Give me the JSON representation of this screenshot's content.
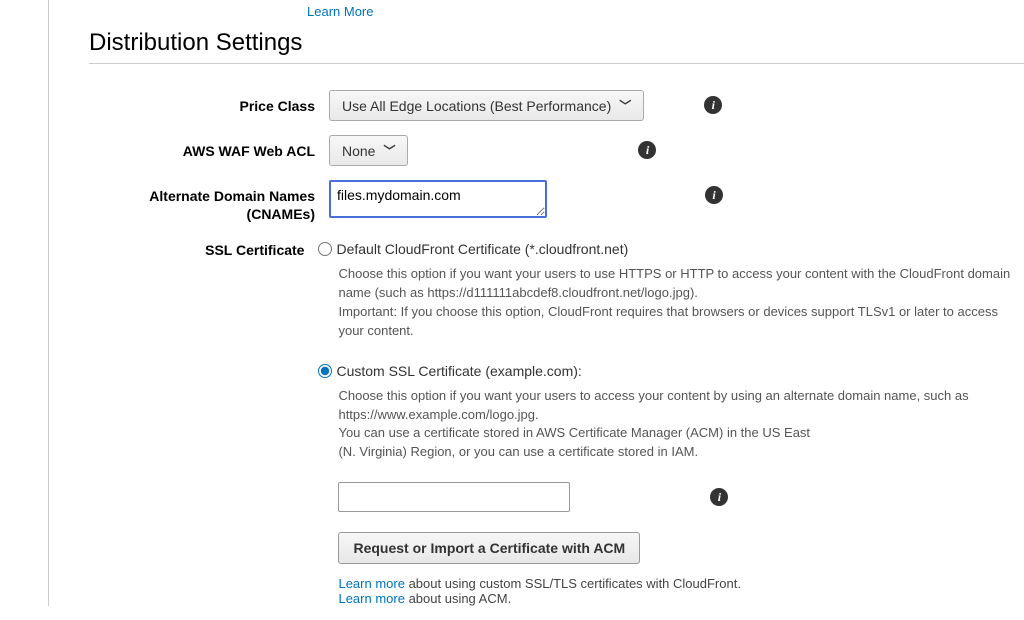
{
  "top_link": "Learn More",
  "section_title": "Distribution Settings",
  "price_class": {
    "label": "Price Class",
    "value": "Use All Edge Locations (Best Performance)"
  },
  "waf": {
    "label": "AWS WAF Web ACL",
    "value": "None"
  },
  "cnames": {
    "label": "Alternate Domain Names\n(CNAMEs)",
    "value": "files.mydomain.com"
  },
  "ssl": {
    "label": "SSL Certificate",
    "default_option": "Default CloudFront Certificate (*.cloudfront.net)",
    "default_desc_1": "Choose this option if you want your users to use HTTPS or HTTP to access your content with the CloudFront domain name (such as https://d111111abcdef8.cloudfront.net/logo.jpg).",
    "default_desc_2": "Important: If you choose this option, CloudFront requires that browsers or devices support TLSv1 or later to access your content.",
    "custom_option": "Custom SSL Certificate (example.com):",
    "custom_desc_1": "Choose this option if you want your users to access your content by using an alternate domain name, such as https://www.example.com/logo.jpg.",
    "custom_desc_2": "You can use a certificate stored in AWS Certificate Manager (ACM) in the US East",
    "custom_desc_3": "(N. Virginia) Region, or you can use a certificate stored in IAM.",
    "cert_value": "",
    "request_btn": "Request or Import a Certificate with ACM",
    "learn1_link": "Learn more",
    "learn1_text": " about using custom SSL/TLS certificates with CloudFront.",
    "learn2_link": "Learn more",
    "learn2_text": " about using ACM."
  }
}
